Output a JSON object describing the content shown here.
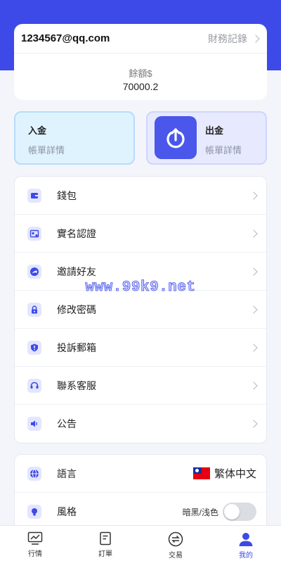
{
  "account": {
    "email": "1234567@qq.com",
    "records_label": "財務記錄",
    "balance_label": "餘額$",
    "balance_value": "70000.2"
  },
  "quick_actions": [
    {
      "title": "入金",
      "subtitle": "帳單詳情",
      "icon": "none"
    },
    {
      "title": "出金",
      "subtitle": "帳單詳情",
      "icon": "upload-arrow-icon"
    }
  ],
  "menu": [
    {
      "label": "錢包",
      "icon": "wallet-icon"
    },
    {
      "label": "實名認證",
      "icon": "id-card-icon"
    },
    {
      "label": "邀請好友",
      "icon": "share-icon"
    },
    {
      "label": "修改密碼",
      "icon": "lock-icon"
    },
    {
      "label": "投訴郵箱",
      "icon": "shield-alert-icon"
    },
    {
      "label": "聯系客服",
      "icon": "headset-icon"
    },
    {
      "label": "公告",
      "icon": "speaker-icon"
    }
  ],
  "settings": {
    "language_label": "語言",
    "language_value": "繁体中文",
    "theme_label": "風格",
    "theme_toggle_label": "暗黑/浅色",
    "theme_dark": false
  },
  "watermark": "www.99k9.net",
  "tabs": [
    {
      "label": "行情",
      "icon": "chart-icon",
      "active": false
    },
    {
      "label": "訂單",
      "icon": "document-icon",
      "active": false
    },
    {
      "label": "交易",
      "icon": "swap-icon",
      "active": false
    },
    {
      "label": "我的",
      "icon": "user-icon",
      "active": true
    }
  ],
  "colors": {
    "primary": "#3d4ae8",
    "deposit_bg": "#dff3ff",
    "withdraw_bg": "#e7eaff",
    "page_bg": "#f4f5fa"
  }
}
